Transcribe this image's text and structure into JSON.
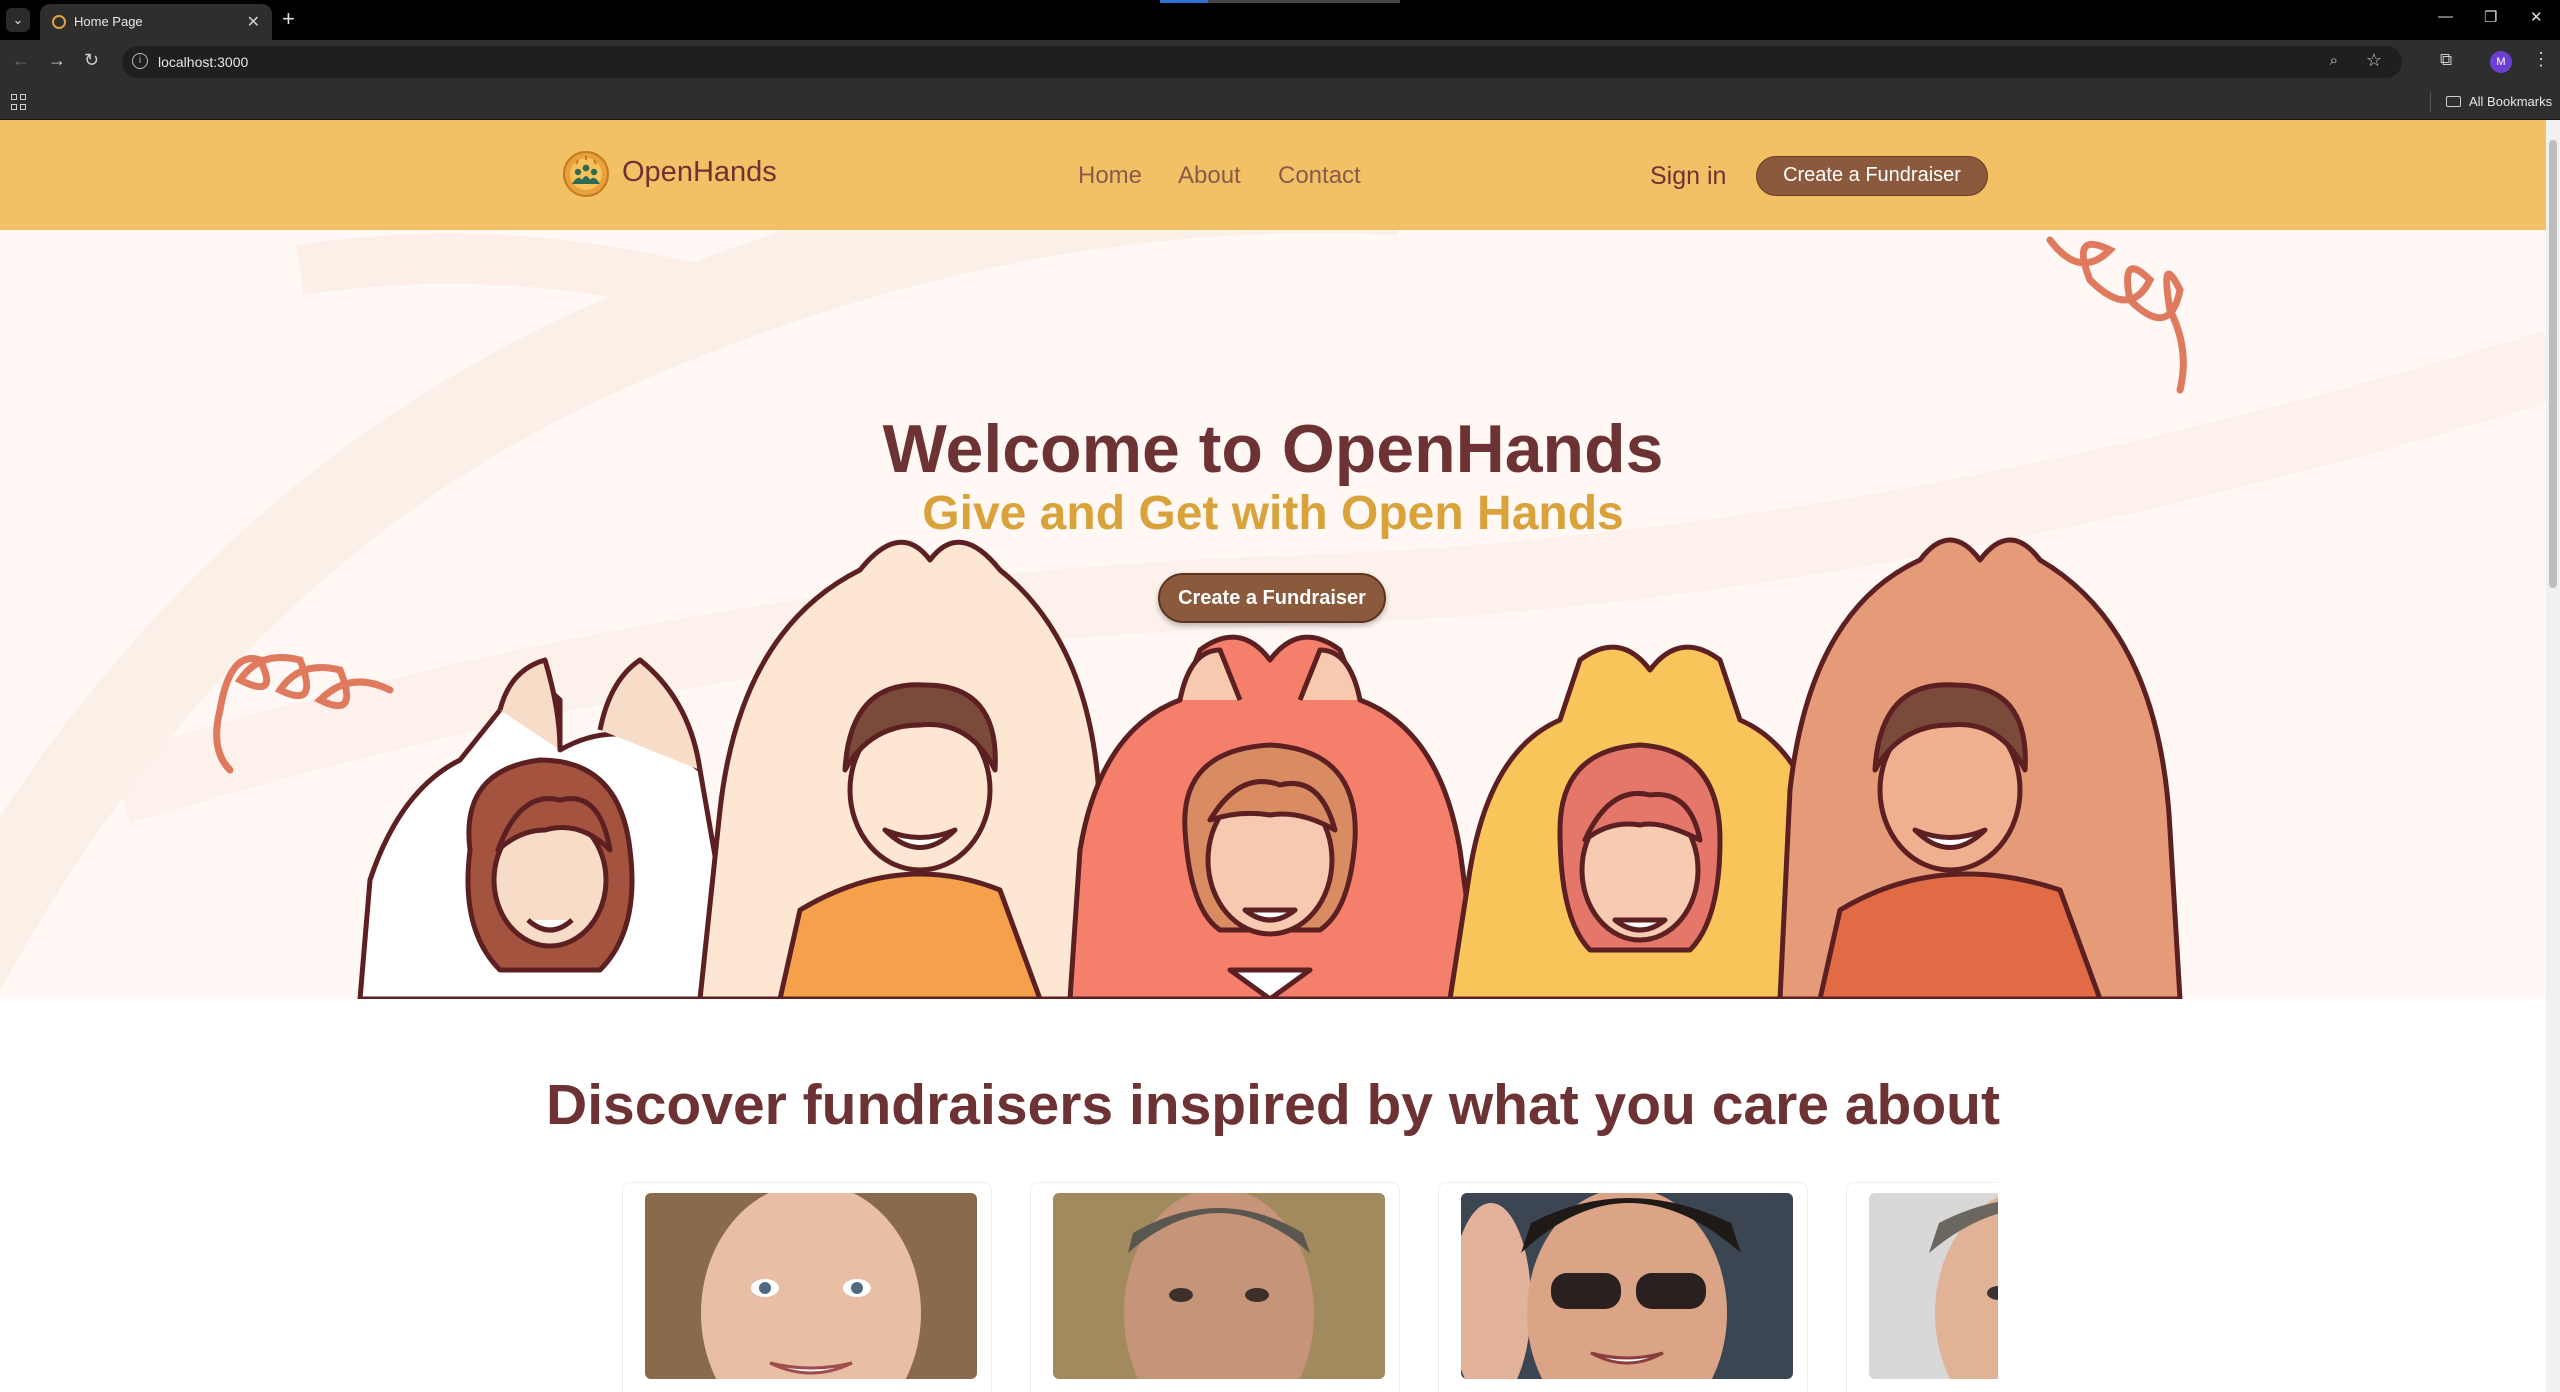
{
  "browser": {
    "tab_title": "Home Page",
    "url": "localhost:3000",
    "profile_initial": "M",
    "all_bookmarks": "All Bookmarks"
  },
  "site": {
    "brand": "OpenHands",
    "nav": {
      "home": "Home",
      "about": "About",
      "contact": "Contact"
    },
    "signin": "Sign in",
    "create_button": "Create a Fundraiser"
  },
  "hero": {
    "title": "Welcome to OpenHands",
    "subtitle": "Give and Get with Open Hands",
    "cta": "Create a Fundraiser"
  },
  "discover": {
    "heading": "Discover fundraisers inspired by what you care about"
  },
  "colors": {
    "header_bg": "#f2c166",
    "brand_brown": "#6d3233",
    "button_brown": "#8b5a3c",
    "accent_gold": "#d9a23a",
    "hero_bg": "#fff8f4"
  }
}
